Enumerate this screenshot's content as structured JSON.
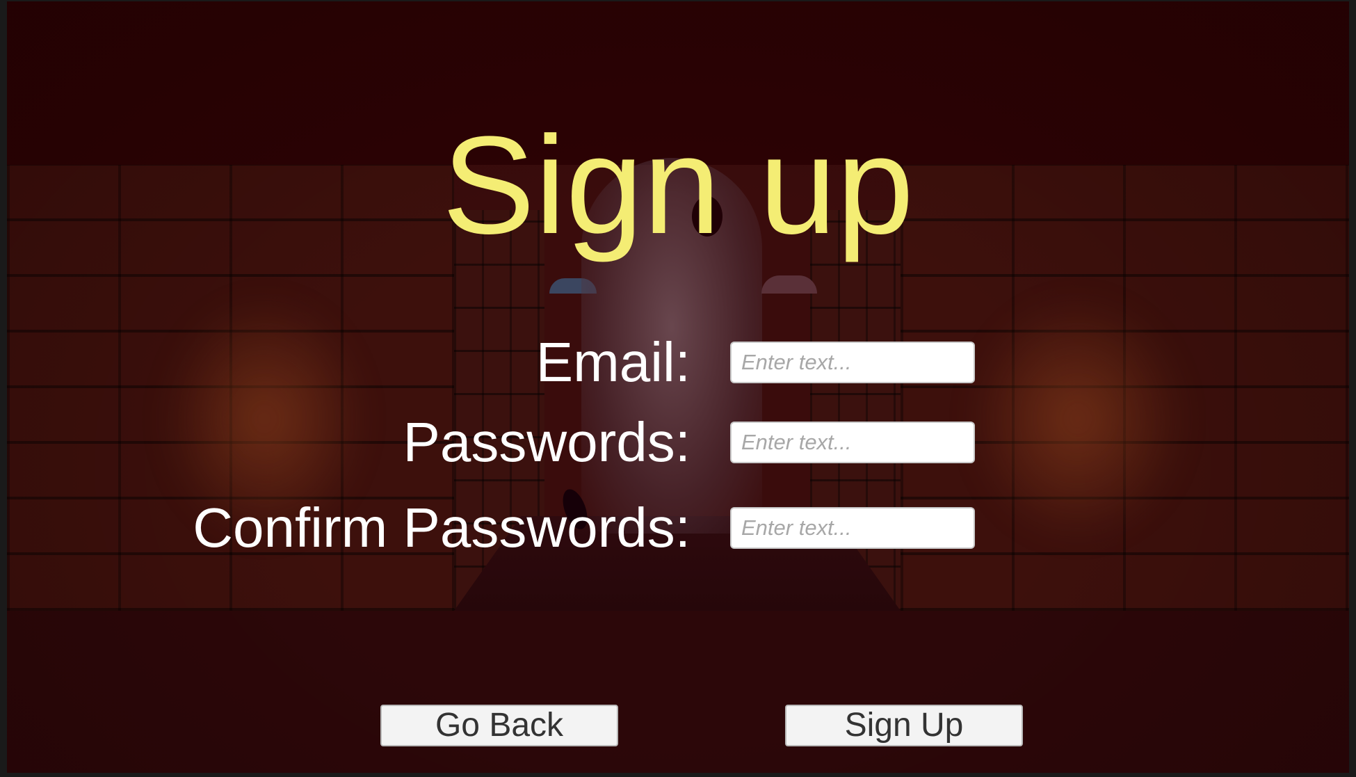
{
  "screen": {
    "title": "Sign up"
  },
  "form": {
    "email": {
      "label": "Email:",
      "placeholder": "Enter text...",
      "value": ""
    },
    "password": {
      "label": "Passwords:",
      "placeholder": "Enter text...",
      "value": ""
    },
    "confirm_password": {
      "label": "Confirm Passwords:",
      "placeholder": "Enter text...",
      "value": ""
    }
  },
  "buttons": {
    "go_back": "Go Back",
    "sign_up": "Sign Up"
  },
  "colors": {
    "title": "#f4ed74",
    "label": "#ffffff",
    "background": "#2c0204",
    "button_bg": "#f3f3f3"
  }
}
